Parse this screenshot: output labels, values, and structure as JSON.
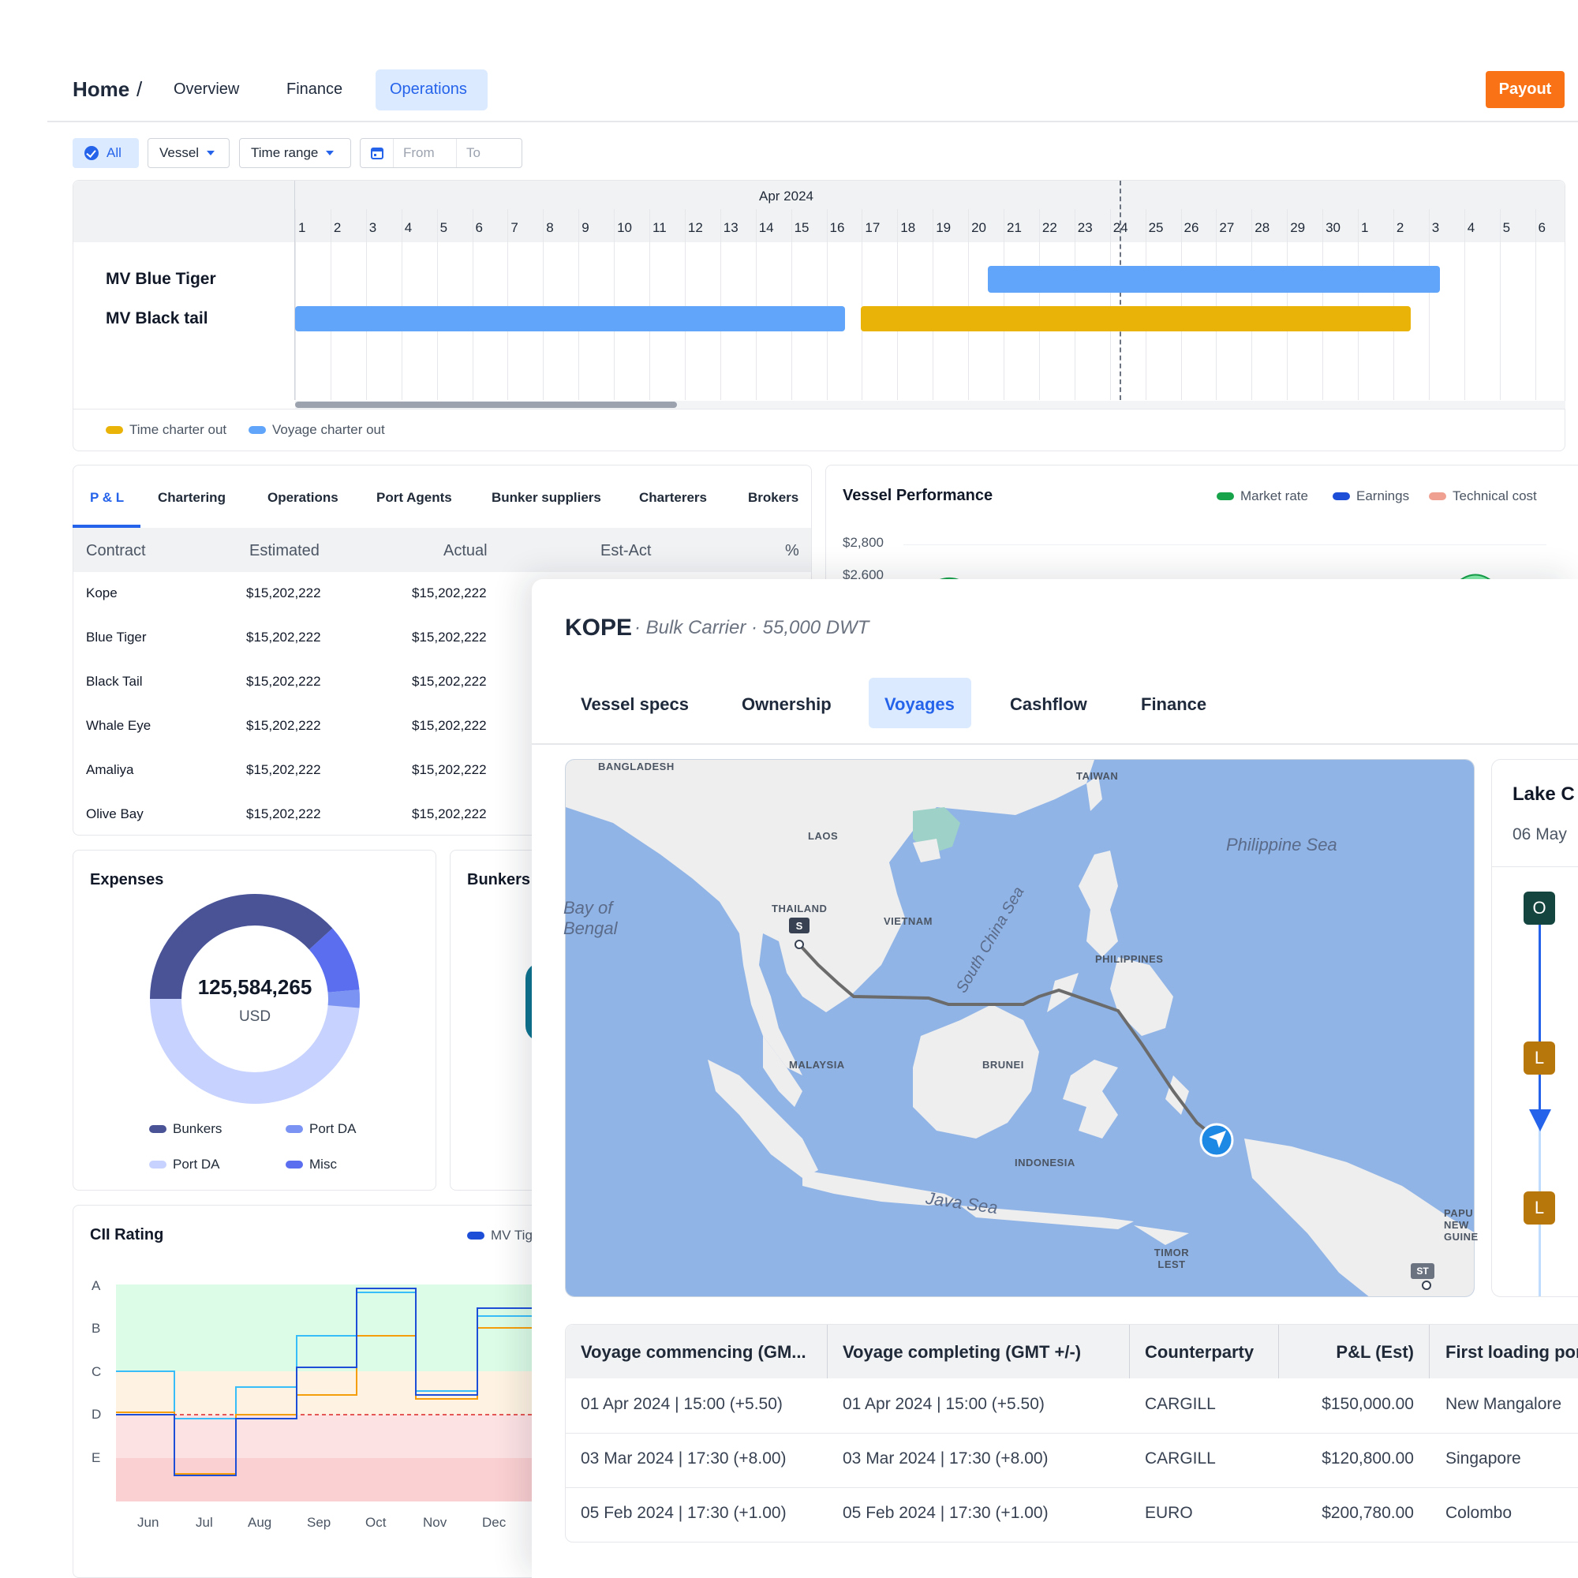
{
  "nav": {
    "home": "Home",
    "separator": "/",
    "tabs": [
      {
        "label": "Overview",
        "active": false
      },
      {
        "label": "Finance",
        "active": false
      },
      {
        "label": "Operations",
        "active": true
      }
    ],
    "payout_label": "Payout"
  },
  "filters": {
    "all": "All",
    "vessel": "Vessel",
    "time_range": "Time range",
    "from_placeholder": "From",
    "to_placeholder": "To"
  },
  "gantt": {
    "month": "Apr 2024",
    "days": [
      "1",
      "2",
      "3",
      "4",
      "5",
      "6",
      "7",
      "8",
      "9",
      "10",
      "11",
      "12",
      "13",
      "14",
      "15",
      "16",
      "17",
      "18",
      "19",
      "20",
      "21",
      "22",
      "23",
      "24",
      "25",
      "26",
      "27",
      "28",
      "29",
      "30",
      "1",
      "2",
      "3",
      "4",
      "5",
      "6"
    ],
    "today_label": "24",
    "vessels": [
      {
        "name": "MV Blue Tiger",
        "bars": [
          {
            "type": "Voyage charter out",
            "start": 20,
            "end": 33
          }
        ]
      },
      {
        "name": "MV Black tail",
        "bars": [
          {
            "type": "Voyage charter out",
            "start": 0,
            "end": 15.5
          },
          {
            "type": "Time charter out",
            "start": 16,
            "end": 31.5
          }
        ]
      }
    ],
    "legend": [
      {
        "label": "Time charter out",
        "color": "#eab308"
      },
      {
        "label": "Voyage charter out",
        "color": "#60a5fa"
      }
    ]
  },
  "pl": {
    "tabs": [
      "P & L",
      "Chartering",
      "Operations",
      "Port Agents",
      "Bunker suppliers",
      "Charterers",
      "Brokers"
    ],
    "columns": [
      "Contract",
      "Estimated",
      "Actual",
      "Est-Act",
      "%"
    ],
    "rows": [
      {
        "contract": "Kope",
        "estimated": "$15,202,222",
        "actual": "$15,202,222"
      },
      {
        "contract": "Blue Tiger",
        "estimated": "$15,202,222",
        "actual": "$15,202,222"
      },
      {
        "contract": "Black Tail",
        "estimated": "$15,202,222",
        "actual": "$15,202,222"
      },
      {
        "contract": "Whale Eye",
        "estimated": "$15,202,222",
        "actual": "$15,202,222"
      },
      {
        "contract": "Amaliya",
        "estimated": "$15,202,222",
        "actual": "$15,202,222"
      },
      {
        "contract": "Olive Bay",
        "estimated": "$15,202,222",
        "actual": "$15,202,222"
      }
    ]
  },
  "vessel_performance": {
    "title": "Vessel Performance",
    "legend": [
      {
        "label": "Market rate",
        "color": "#16a34a"
      },
      {
        "label": "Earnings",
        "color": "#1d4ed8"
      },
      {
        "label": "Technical cost",
        "color": "#f0a090"
      }
    ],
    "y_ticks": [
      "$2,800",
      "$2,600"
    ]
  },
  "expenses": {
    "title": "Expenses",
    "total": "125,584,265",
    "currency": "USD",
    "legend": [
      {
        "label": "Bunkers",
        "color": "#4a5396"
      },
      {
        "label": "Port DA",
        "color": "#7b93f2"
      },
      {
        "label": "Port DA",
        "color": "#c7d2fe"
      },
      {
        "label": "Misc",
        "color": "#5b6ef0"
      }
    ]
  },
  "bunkers": {
    "title": "Bunkers"
  },
  "cii": {
    "title": "CII Rating",
    "legend_label": "MV Tig",
    "grades": [
      "A",
      "B",
      "C",
      "D",
      "E"
    ],
    "months": [
      "Jun",
      "Jul",
      "Aug",
      "Sep",
      "Oct",
      "Nov",
      "Dec"
    ]
  },
  "kope": {
    "name": "KOPE",
    "subtitle": "· Bulk Carrier · 55,000 DWT",
    "tabs": [
      {
        "label": "Vessel specs",
        "active": false
      },
      {
        "label": "Ownership",
        "active": false
      },
      {
        "label": "Voyages",
        "active": true
      },
      {
        "label": "Cashflow",
        "active": false
      },
      {
        "label": "Finance",
        "active": false
      }
    ],
    "map": {
      "labels": [
        "BANGLADESH",
        "TAIWAN",
        "LAOS",
        "THAILAND",
        "VIETNAM",
        "PHILIPPINES",
        "MALAYSIA",
        "BRUNEI",
        "INDONESIA",
        "TIMOR LEST",
        "PAPU NEW GUINE"
      ],
      "seas": [
        "Philippine Sea",
        "Bay of Bengal",
        "South China Sea",
        "Java Sea"
      ],
      "start_marker": "S",
      "end_marker": "ST"
    },
    "side_card": {
      "title": "Lake C",
      "date": "06 May",
      "markers": [
        "O",
        "L",
        "L"
      ]
    },
    "voyages": {
      "columns": [
        "Voyage commencing (GM...",
        "Voyage completing (GMT +/-)",
        "Counterparty",
        "P&L (Est)",
        "First loading por"
      ],
      "rows": [
        {
          "commencing": "01 Apr 2024 | 15:00 (+5.50)",
          "completing": "01 Apr 2024 | 15:00 (+5.50)",
          "counterparty": "CARGILL",
          "pl": "$150,000.00",
          "port": "New Mangalore"
        },
        {
          "commencing": "03 Mar 2024 | 17:30 (+8.00)",
          "completing": "03 Mar 2024 | 17:30 (+8.00)",
          "counterparty": "CARGILL",
          "pl": "$120,800.00",
          "port": "Singapore"
        },
        {
          "commencing": "05 Feb 2024 | 17:30 (+1.00)",
          "completing": "05 Feb 2024 | 17:30 (+1.00)",
          "counterparty": "EURO",
          "pl": "$200,780.00",
          "port": "Colombo"
        }
      ]
    }
  }
}
